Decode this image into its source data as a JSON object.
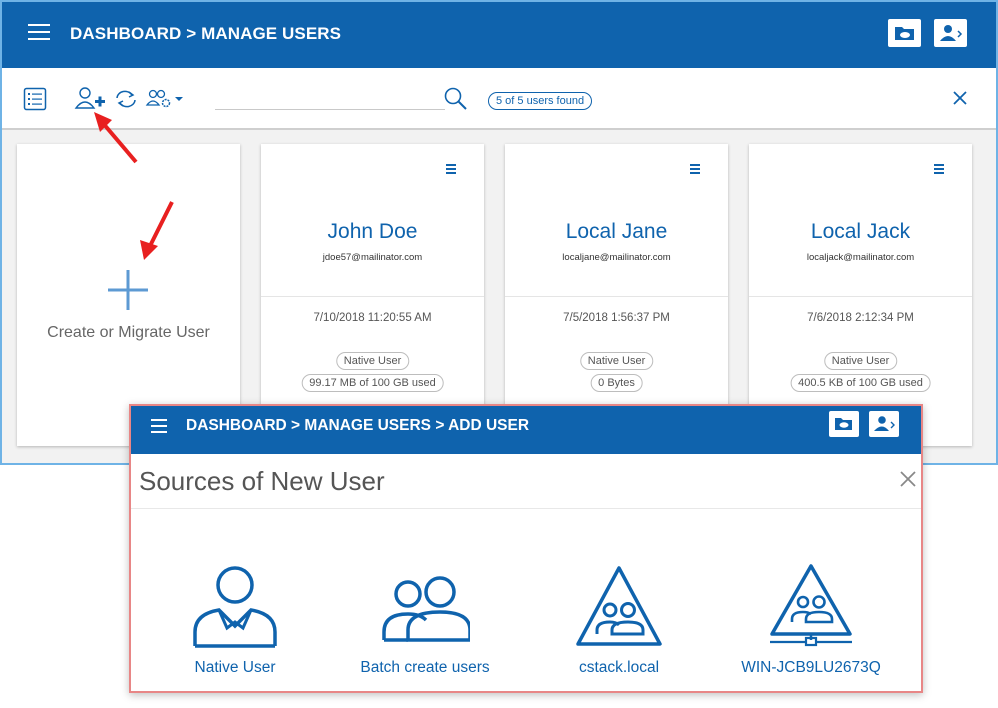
{
  "main": {
    "breadcrumb": "DASHBOARD > MANAGE USERS",
    "search": {
      "value": "",
      "placeholder": ""
    },
    "found_badge": "5 of 5 users found"
  },
  "cards": {
    "create_label": "Create or Migrate User",
    "users": [
      {
        "name": "John Doe",
        "email": "jdoe57@mailinator.com",
        "date": "7/10/2018 11:20:55 AM",
        "type": "Native User",
        "usage": "99.17 MB of 100 GB used"
      },
      {
        "name": "Local Jane",
        "email": "localjane@mailinator.com",
        "date": "7/5/2018 1:56:37 PM",
        "type": "Native User",
        "usage": "0 Bytes"
      },
      {
        "name": "Local Jack",
        "email": "localjack@mailinator.com",
        "date": "7/6/2018 2:12:34 PM",
        "type": "Native User",
        "usage": "400.5 KB of 100 GB used"
      }
    ]
  },
  "popup": {
    "breadcrumb": "DASHBOARD > MANAGE USERS > ADD USER",
    "heading": "Sources of New User",
    "sources": [
      {
        "label": "Native User",
        "icon": "single-user-icon"
      },
      {
        "label": "Batch create users",
        "icon": "two-users-icon"
      },
      {
        "label": "cstack.local",
        "icon": "domain-triangle-icon"
      },
      {
        "label": "WIN-JCB9LU2673Q",
        "icon": "network-triangle-icon"
      }
    ]
  },
  "colors": {
    "accent": "#0f63ad",
    "arrow": "#e82020",
    "popup_border": "#e88686"
  }
}
